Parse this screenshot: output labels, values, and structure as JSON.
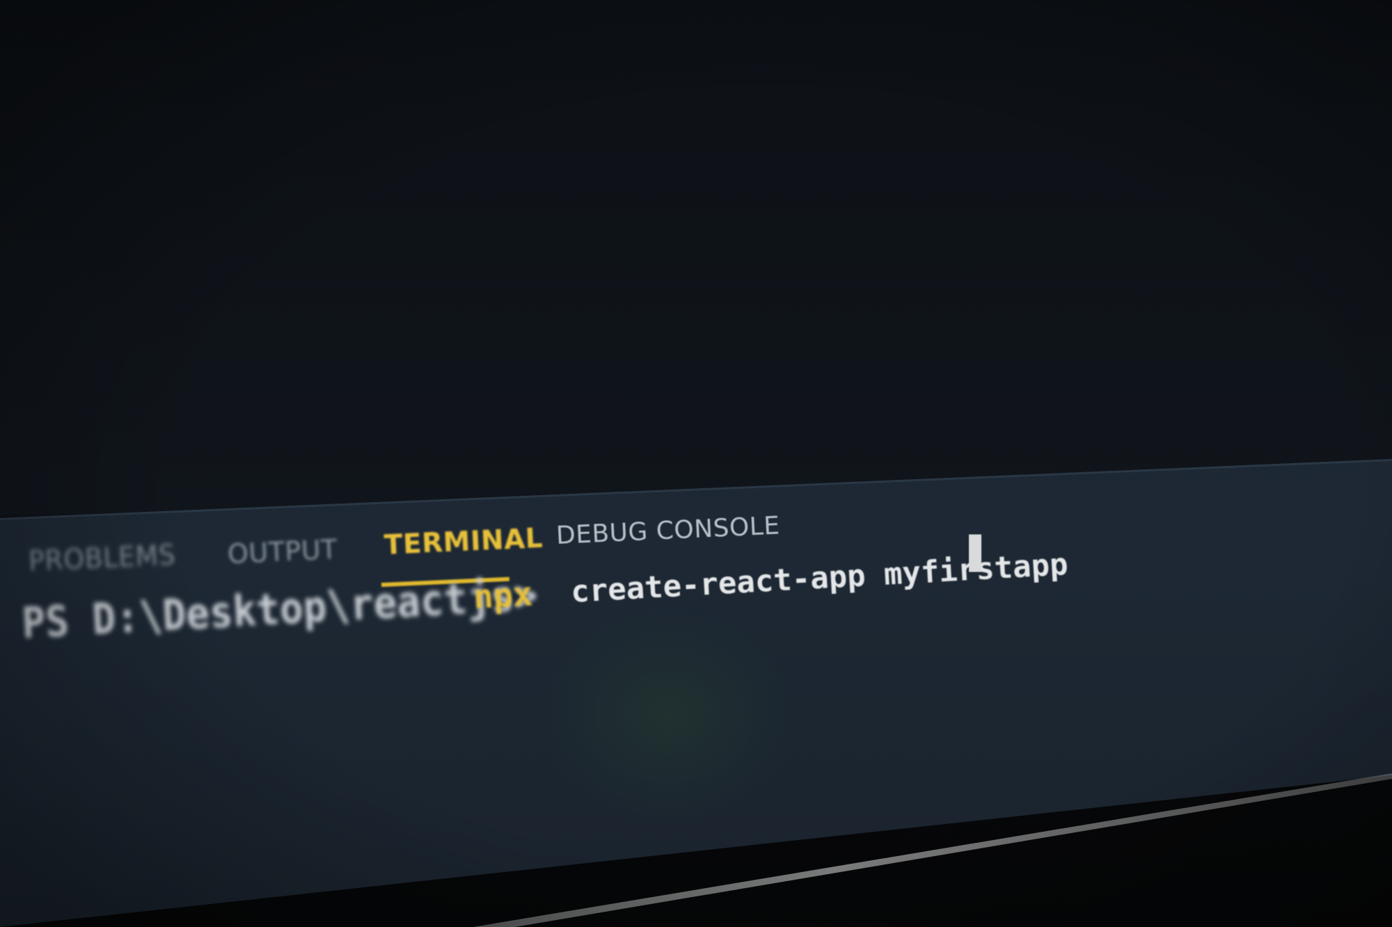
{
  "panel": {
    "tabs": [
      {
        "label": "PROBLEMS",
        "active": false
      },
      {
        "label": "OUTPUT",
        "active": false
      },
      {
        "label": "TERMINAL",
        "active": true
      },
      {
        "label": "DEBUG CONSOLE",
        "active": false
      }
    ]
  },
  "terminal": {
    "prompt": "PS D:\\Desktop\\reactjs>",
    "command": "npx",
    "arguments": "create-react-app myfirstapp"
  },
  "colors": {
    "accent": "#e8c13a",
    "panel_bg": "#1c2834",
    "editor_bg": "#0d1116",
    "text": "#e4e6e8"
  }
}
